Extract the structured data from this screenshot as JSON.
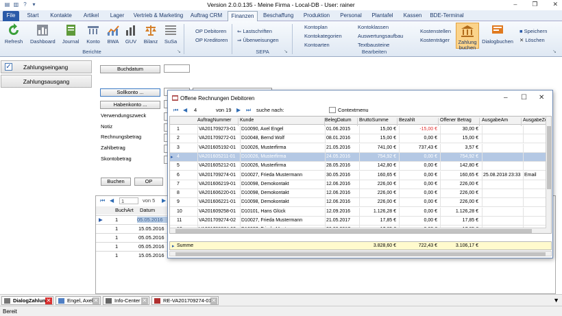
{
  "window": {
    "title": "Version 2.0.0.135 - Meine Firma - Local-DB - User: rainer",
    "minimize": "–",
    "maximize": "❐",
    "close": "✕"
  },
  "ribbon_tabs": [
    "File",
    "Start",
    "Kontakte",
    "Artikel",
    "Lager",
    "Vertrieb & Marketing",
    "Auftrag CRM",
    "Finanzen",
    "Beschaffung",
    "Produktion",
    "Personal",
    "Plantafel",
    "Kassen",
    "BDE-Terminal"
  ],
  "active_tab": "Finanzen",
  "ribbon": {
    "berichte": {
      "label": "Berichte",
      "buttons": [
        "Refresh",
        "Dashboard",
        "Journal",
        "Konto",
        "BWA",
        "GUV",
        "Bilanz",
        "SuSa"
      ]
    },
    "op": {
      "op_debitoren": "OP Debitoren",
      "op_kreditoren": "OP Kreditoren"
    },
    "sepa": {
      "label": "SEPA",
      "lastschriften": "Lastschriften",
      "ueberweisungen": "Überweisungen"
    },
    "bearbeiten": {
      "label": "Bearbeiten",
      "col1": [
        "Kontoplan",
        "Kontokategorien",
        "Kontoarten"
      ],
      "col2": [
        "Kontoklassen",
        "Auswertungsaufbau",
        "Textbausteine"
      ],
      "col3": [
        "Kostenstellen",
        "Kostenträger"
      ]
    },
    "zahlung_buchen": "Zahlung buchen",
    "dialogbuchen": "Dialogbuchen",
    "speichern": "Speichern",
    "loeschen": "Löschen"
  },
  "left_nav": {
    "zahlungseingang": "Zahlungseingang",
    "zahlungsausgang": "Zahlungsausgang"
  },
  "form": {
    "buchdatum": "Buchdatum",
    "sollkonto": "Sollkonto ...",
    "habenkonto": "Habenkonto ...",
    "verwendungszweck": "Verwendungszweck",
    "notiz": "Notiz",
    "rechnungsbetrag": "Rechnungsbetrag",
    "zahlbetrag": "Zahlbetrag",
    "skontobetrag": "Skontobetrag",
    "buchen": "Buchen",
    "op": "OP"
  },
  "bottom_grid": {
    "nav_page": "1",
    "nav_of": "von 5",
    "headers": [
      "BuchArt",
      "Datum"
    ],
    "rows": [
      {
        "art": "1",
        "datum": "05.05.2016"
      },
      {
        "art": "1",
        "datum": "15.05.2016"
      },
      {
        "art": "1",
        "datum": "05.05.2016"
      },
      {
        "art": "1",
        "datum": "05.05.2016"
      },
      {
        "art": "1",
        "datum": "15.05.2016"
      }
    ]
  },
  "dialog": {
    "title": "Offene Rechnungen Debitoren",
    "page": "4",
    "of": "von 19",
    "search_label": "suche nach:",
    "contextmenu": "Contextmenu",
    "headers": [
      "AuftragNummer",
      "Kunde",
      "BelegDatum",
      "BruttoSumme",
      "Bezahlt",
      "Offener Betrag",
      "AusgabeAm",
      "AusgabeZe"
    ],
    "rows": [
      {
        "n": "1",
        "auftrag": "VA201709273-01",
        "kunde": "D10090, Axel Engel",
        "datum": "01.06.2015",
        "brutto": "15,00 €",
        "bezahlt": "-15,00 €",
        "offen": "30,00 €",
        "ausgabe": "",
        "zeit": "",
        "neg": true
      },
      {
        "n": "2",
        "auftrag": "VA201709272-01",
        "kunde": "D10048, Bernd Wolf",
        "datum": "08.01.2016",
        "brutto": "15,00 €",
        "bezahlt": "0,00 €",
        "offen": "15,00 €",
        "ausgabe": "",
        "zeit": ""
      },
      {
        "n": "3",
        "auftrag": "VA201605192-01",
        "kunde": "D10026, Musterfirma",
        "datum": "21.05.2016",
        "brutto": "741,00 €",
        "bezahlt": "737,43 €",
        "offen": "3,57 €",
        "ausgabe": "",
        "zeit": ""
      },
      {
        "n": "4",
        "auftrag": "VA201605211-01",
        "kunde": "D10026, Musterfirma",
        "datum": "24.05.2016",
        "brutto": "754,92 €",
        "bezahlt": "0,00 €",
        "offen": "754,92 €",
        "ausgabe": "",
        "zeit": "",
        "sel": true
      },
      {
        "n": "5",
        "auftrag": "VA201605212-01",
        "kunde": "D10026, Musterfirma",
        "datum": "28.05.2016",
        "brutto": "142,80 €",
        "bezahlt": "0,00 €",
        "offen": "142,80 €",
        "ausgabe": "",
        "zeit": ""
      },
      {
        "n": "6",
        "auftrag": "VA201709274-01",
        "kunde": "D10027, Frieda Mustermann",
        "datum": "30.05.2016",
        "brutto": "160,65 €",
        "bezahlt": "0,00 €",
        "offen": "160,65 €",
        "ausgabe": "25.08.2018 23:33",
        "zeit": "Email"
      },
      {
        "n": "7",
        "auftrag": "VA201606219-01",
        "kunde": "D10098, Demokontakt",
        "datum": "12.06.2016",
        "brutto": "226,00 €",
        "bezahlt": "0,00 €",
        "offen": "226,00 €",
        "ausgabe": "",
        "zeit": ""
      },
      {
        "n": "8",
        "auftrag": "VA201606220-01",
        "kunde": "D10098, Demokontakt",
        "datum": "12.06.2016",
        "brutto": "226,00 €",
        "bezahlt": "0,00 €",
        "offen": "226,00 €",
        "ausgabe": "",
        "zeit": ""
      },
      {
        "n": "9",
        "auftrag": "VA201606221-01",
        "kunde": "D10098, Demokontakt",
        "datum": "12.06.2016",
        "brutto": "226,00 €",
        "bezahlt": "0,00 €",
        "offen": "226,00 €",
        "ausgabe": "",
        "zeit": ""
      },
      {
        "n": "10",
        "auftrag": "VA201609258-01",
        "kunde": "D10101, Hans Glück",
        "datum": "12.09.2016",
        "brutto": "1.126,28 €",
        "bezahlt": "0,00 €",
        "offen": "1.126,28 €",
        "ausgabe": "",
        "zeit": ""
      },
      {
        "n": "11",
        "auftrag": "VA201709274-02",
        "kunde": "D10027, Frieda Mustermann",
        "datum": "21.05.2017",
        "brutto": "17,85 €",
        "bezahlt": "0,00 €",
        "offen": "17,85 €",
        "ausgabe": "",
        "zeit": ""
      },
      {
        "n": "12",
        "auftrag": "VA201709274-03",
        "kunde": "D10027, Frieda Mustermann",
        "datum": "30.03.2017",
        "brutto": "17,85 €",
        "bezahlt": "0,00 €",
        "offen": "17,85 €",
        "ausgabe": "",
        "zeit": ""
      }
    ],
    "sum": {
      "label": "Summe",
      "brutto": "3.828,60 €",
      "bezahlt": "722,43 €",
      "offen": "3.106,17 €"
    }
  },
  "doc_tabs": [
    "DialogZahlung",
    "Engel, Axel",
    "Info-Center",
    "RE-VA201709274-01"
  ],
  "status": "Bereit",
  "colors": {
    "accent": "#2a5aa8",
    "selection": "#b4c8e4",
    "sum_bg": "#fffacd",
    "negative": "#e03030",
    "close_active": "#d83030"
  }
}
